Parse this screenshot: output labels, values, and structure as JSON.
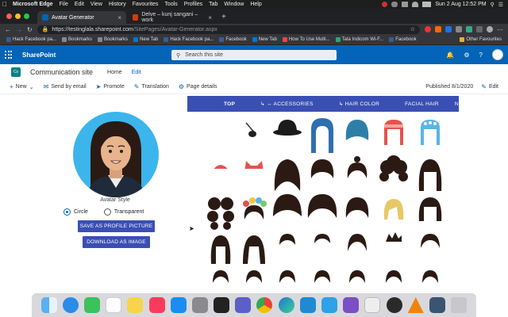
{
  "menubar": {
    "app": "Microsoft Edge",
    "items": [
      "File",
      "Edit",
      "View",
      "History",
      "Favourites",
      "Tools",
      "Profiles",
      "Tab",
      "Window",
      "Help"
    ],
    "clock": "Sun 2 Aug  12:52 PM"
  },
  "tabs": [
    {
      "title": "Avatar Generator",
      "color": "#0364b8"
    },
    {
      "title": "Delve – kunj sangani – work",
      "color": "#d83b01"
    }
  ],
  "address": {
    "host": "https://testinglala.sharepoint.com",
    "path": "/SitePages/Avatar-Generator.aspx"
  },
  "bookmarks": [
    {
      "label": "Hack Facebook pa...",
      "color": "#3b5998"
    },
    {
      "label": "Bookmarks",
      "color": "#888"
    },
    {
      "label": "Bookmarks",
      "color": "#888"
    },
    {
      "label": "New Tab",
      "color": "#0078d4"
    },
    {
      "label": "Hack Facebook pa...",
      "color": "#3b5998"
    },
    {
      "label": "Facebook",
      "color": "#3b5998"
    },
    {
      "label": "New Tab",
      "color": "#0078d4"
    },
    {
      "label": "How To Use Multi...",
      "color": "#e44"
    },
    {
      "label": "Tata Indicom Wi-F...",
      "color": "#2a7"
    },
    {
      "label": "Facebook",
      "color": "#3b5998"
    }
  ],
  "other_bookmarks": "Other Favourites",
  "suite": {
    "brand": "SharePoint",
    "search_placeholder": "Search this site"
  },
  "site": {
    "logo": "Cs",
    "name": "Communication site",
    "nav_home": "Home",
    "nav_edit": "Edit"
  },
  "commands": {
    "new": "New",
    "send": "Send by email",
    "promote": "Promote",
    "translation": "Translation",
    "details": "Page details",
    "published": "Published 8/1/2020",
    "edit": "Edit"
  },
  "avatar": {
    "style_label": "Avatar Style",
    "circle": "Circle",
    "transparent": "Transparent",
    "save_btn": "SAVE AS PROFILE PICTURE",
    "download_btn": "DOWNLOAD AS IMAGE",
    "bg_color": "#3bb5ec"
  },
  "categories": [
    {
      "label": "TOP",
      "active": true
    },
    {
      "label": "↳ ↔ ACCESSORIES",
      "active": false
    },
    {
      "label": "↳ HAIR COLOR",
      "active": false
    },
    {
      "label": "FACIAL HAIR",
      "active": false
    },
    {
      "label": "N",
      "active": false
    }
  ],
  "dock_apps": [
    "finder",
    "safari",
    "facetime",
    "reminders",
    "notes",
    "music",
    "app-store",
    "system-preferences",
    "terminal",
    "teams",
    "chrome",
    "edge",
    "vscode",
    "azure",
    "visual-studio",
    "stickies",
    "obs",
    "vlc",
    "screen",
    "trash"
  ]
}
